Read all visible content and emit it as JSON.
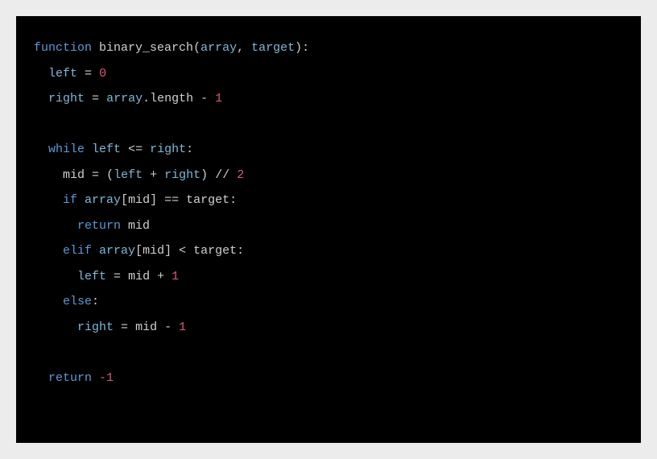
{
  "tokens": {
    "kw_function": "function",
    "fn_name": "binary_search",
    "param_array": "array",
    "param_target": "target",
    "var_left": "left",
    "var_right": "right",
    "var_mid": "mid",
    "num_0": "0",
    "num_1": "1",
    "num_2": "2",
    "num_neg1": "-1",
    "op_eq": "=",
    "op_plus": "+",
    "op_minus": "-",
    "op_lte": "<=",
    "op_lt": "<",
    "op_eqeq": "==",
    "op_floordiv": "//",
    "kw_while": "while",
    "kw_if": "if",
    "kw_elif": "elif",
    "kw_else": "else",
    "kw_return": "return",
    "prop_length": "length",
    "dot": ".",
    "comma": ",",
    "colon": ":",
    "lparen": "(",
    "rparen": ")",
    "lbracket": "[",
    "rbracket": "]"
  }
}
